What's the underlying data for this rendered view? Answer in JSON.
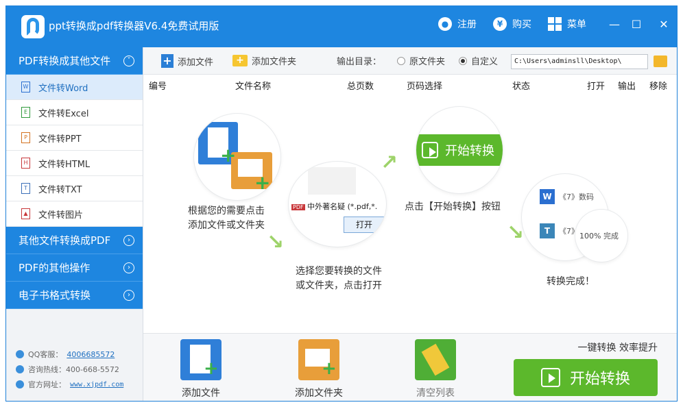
{
  "app": {
    "title": "ppt转换成pdf转换器V6.4免费试用版",
    "register": "注册",
    "buy": "购买",
    "menu": "菜单"
  },
  "sidebar": {
    "cat_pdf_to_other": "PDF转换成其他文件",
    "items": [
      {
        "label": "文件转Word",
        "icon": "W"
      },
      {
        "label": "文件转Excel",
        "icon": "E"
      },
      {
        "label": "文件转PPT",
        "icon": "P"
      },
      {
        "label": "文件转HTML",
        "icon": "H"
      },
      {
        "label": "文件转TXT",
        "icon": "T"
      },
      {
        "label": "文件转图片",
        "icon": "▲"
      }
    ],
    "cat_other_to_pdf": "其他文件转换成PDF",
    "cat_pdf_ops": "PDF的其他操作",
    "cat_ebook": "电子书格式转换",
    "qq_label": "QQ客服：",
    "qq_value": "4006685572",
    "hotline": "咨询热线：400-668-5572",
    "site_label": "官方网址：",
    "site_value": "www.xjpdf.com"
  },
  "toolbar": {
    "add_file": "添加文件",
    "add_folder": "添加文件夹",
    "output_dir": "输出目录：",
    "original_folder": "原文件夹",
    "custom": "自定义",
    "path": "C:\\Users\\adminsll\\Desktop\\"
  },
  "table": {
    "headers": [
      "编号",
      "文件名称",
      "总页数",
      "页码选择",
      "状态",
      "打开",
      "输出",
      "移除"
    ]
  },
  "guide": {
    "step1": "根据您的需要点击\n添加文件或文件夹",
    "step2_file": "中外著名疑",
    "step2_ext": "(*.pdf,*.",
    "step2_open": "打开",
    "step2": "选择您要转换的文件\n或文件夹，点击打开",
    "step3_btn": "开始转换",
    "step3": "点击【开始转换】按钮",
    "step4_item1": "《7》数码",
    "step4_item2": "《7》",
    "step4_progress": "100%",
    "step4_done": "完成",
    "step4": "转换完成！"
  },
  "bottom": {
    "add_file": "添加文件",
    "add_folder": "添加文件夹",
    "clear_list": "清空列表",
    "slogan": "一键转换  效率提升",
    "start": "开始转换"
  }
}
